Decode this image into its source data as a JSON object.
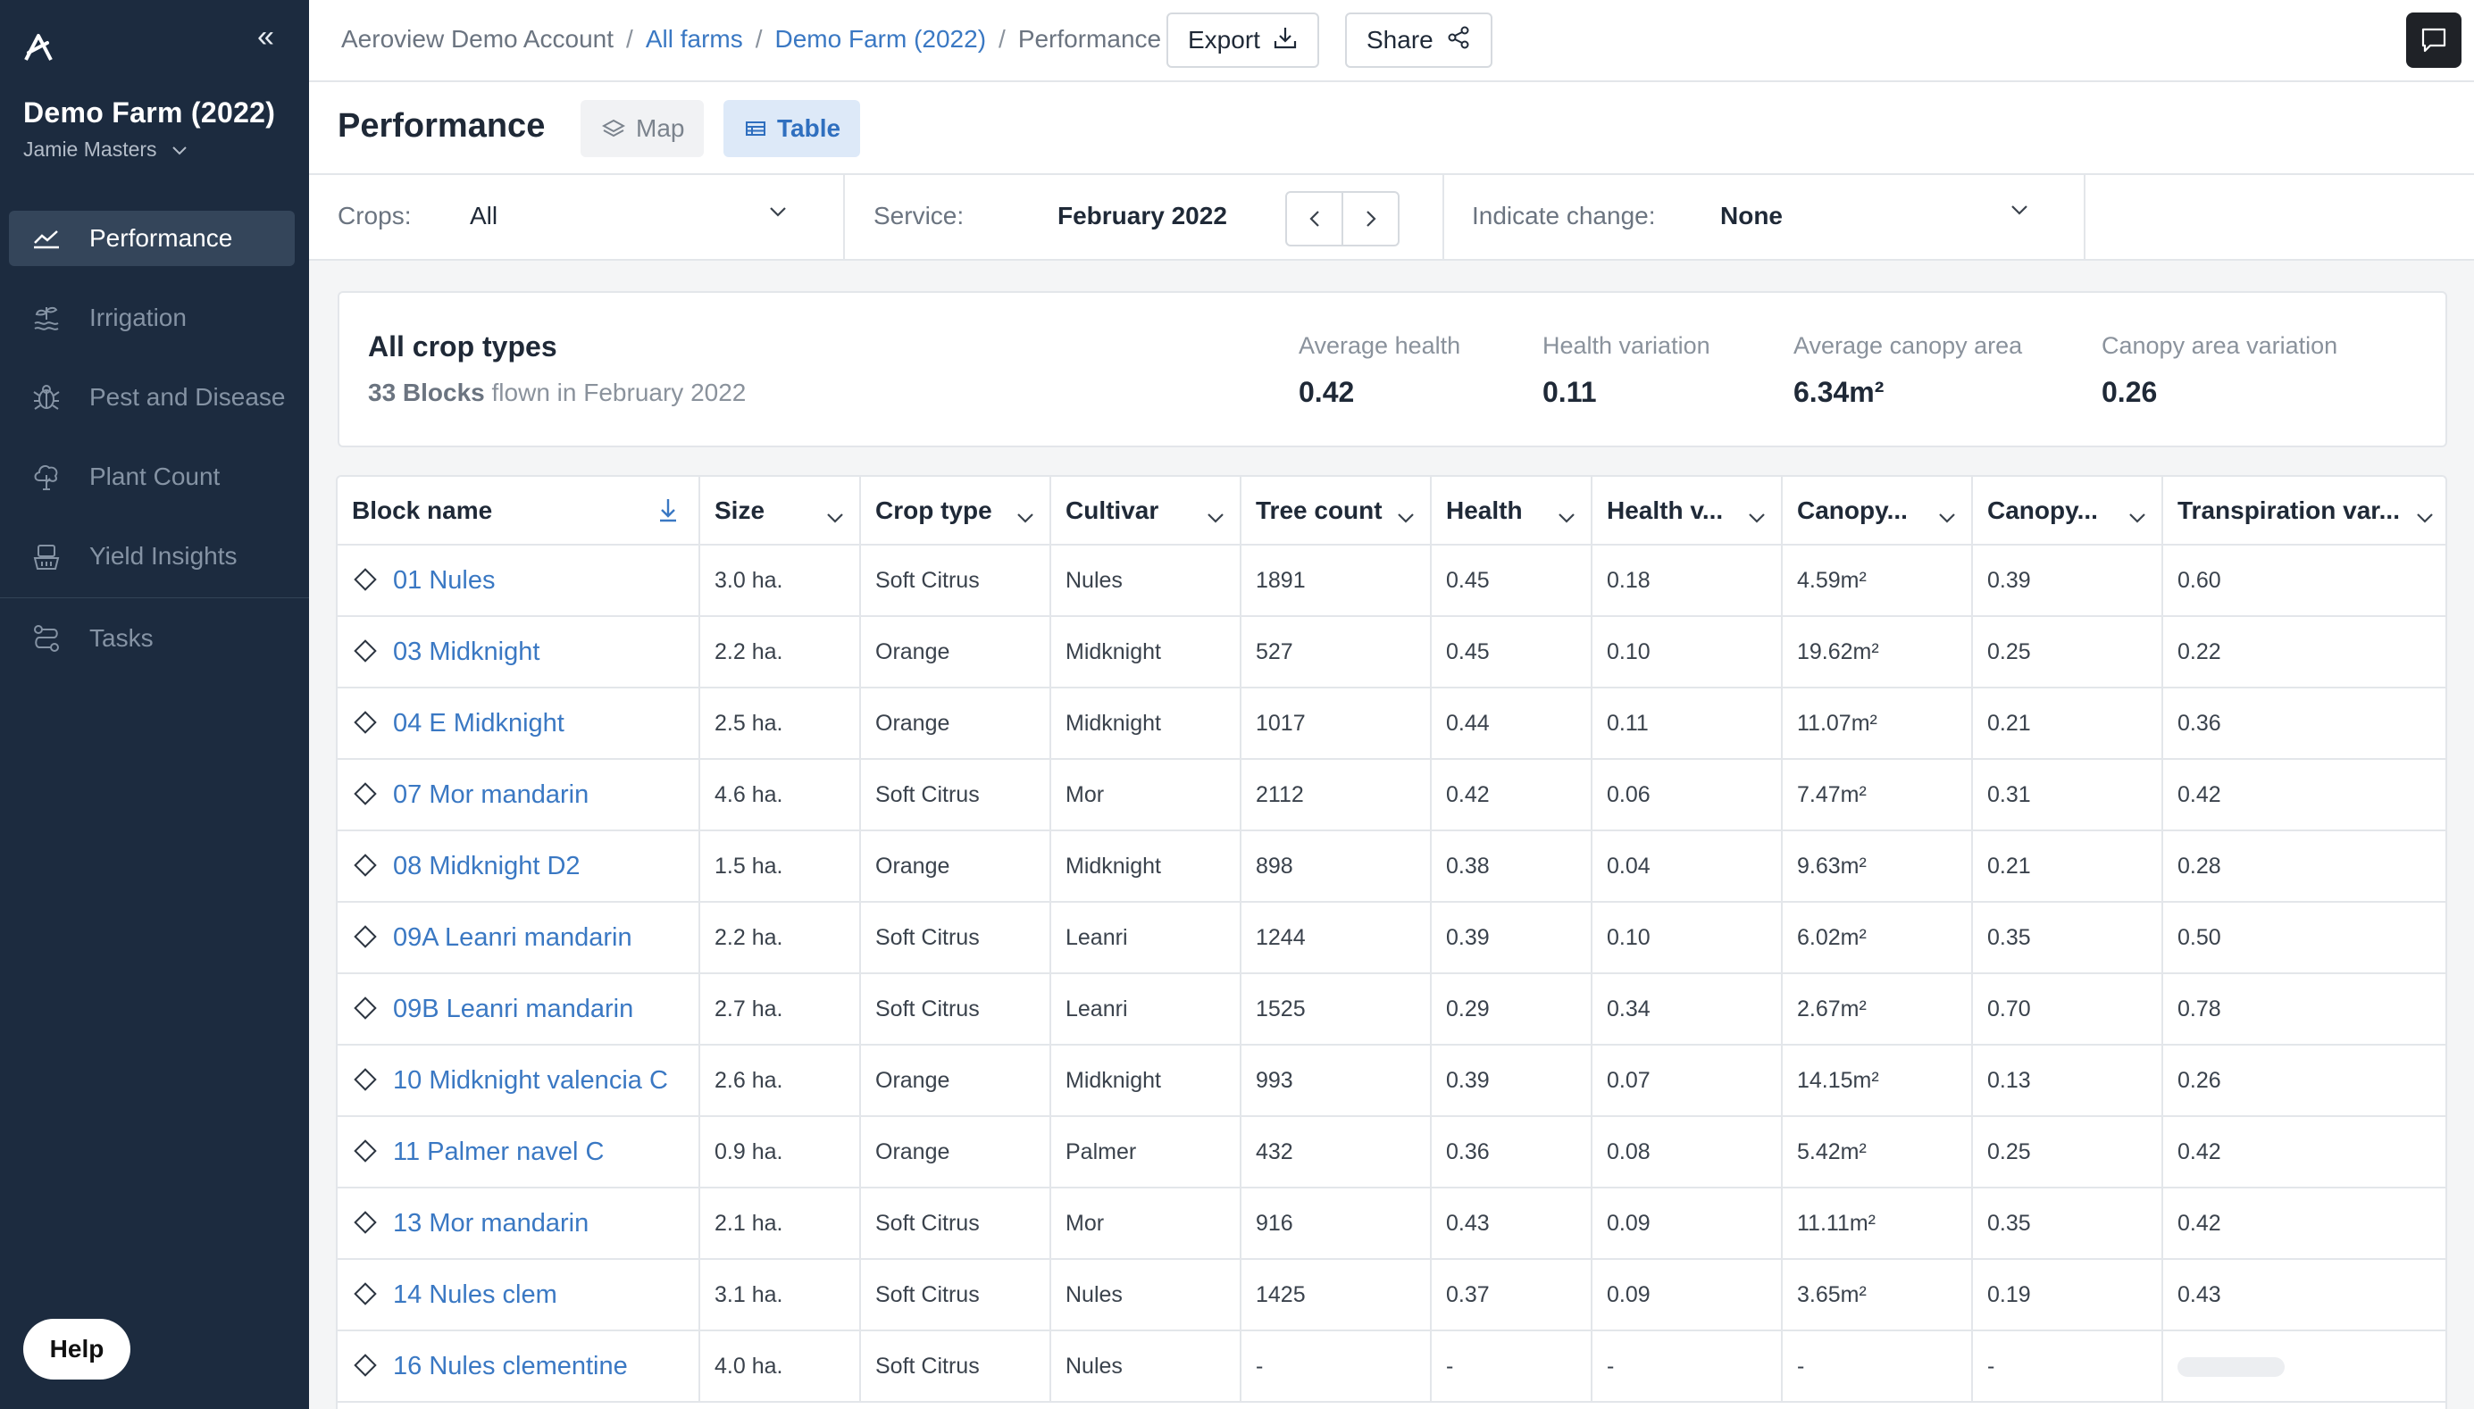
{
  "sidebar": {
    "farm_title": "Demo Farm (2022)",
    "user_name": "Jamie Masters",
    "nav": [
      {
        "label": "Performance",
        "icon": "chart-line-icon",
        "active": true
      },
      {
        "label": "Irrigation",
        "icon": "sprout-water-icon"
      },
      {
        "label": "Pest and Disease",
        "icon": "bug-icon"
      },
      {
        "label": "Plant Count",
        "icon": "tree-icon"
      },
      {
        "label": "Yield Insights",
        "icon": "basket-icon"
      },
      {
        "label": "Tasks",
        "icon": "route-icon"
      }
    ],
    "help_label": "Help"
  },
  "breadcrumb": {
    "account": "Aeroview Demo Account",
    "all_farms": "All farms",
    "farm": "Demo Farm (2022)",
    "current": "Performance"
  },
  "toolbar": {
    "export_label": "Export",
    "share_label": "Share"
  },
  "page": {
    "title": "Performance",
    "view_tabs": {
      "map": "Map",
      "table": "Table",
      "active": "Table"
    }
  },
  "filters": {
    "crops_label": "Crops:",
    "crops_value": "All",
    "service_label": "Service:",
    "service_value": "February 2022",
    "indicate_label": "Indicate change:",
    "indicate_value": "None"
  },
  "summary": {
    "title": "All crop types",
    "blocks_count": "33 Blocks",
    "blocks_suffix": "flown in February 2022",
    "stats": [
      {
        "label": "Average health",
        "value": "0.42"
      },
      {
        "label": "Health variation",
        "value": "0.11"
      },
      {
        "label": "Average canopy area",
        "value": "6.34m²"
      },
      {
        "label": "Canopy area variation",
        "value": "0.26"
      }
    ]
  },
  "table": {
    "columns": [
      "Block name",
      "Size",
      "Crop type",
      "Cultivar",
      "Tree count",
      "Health",
      "Health v...",
      "Canopy...",
      "Canopy...",
      "Transpiration var..."
    ],
    "rows": [
      [
        "01 Nules",
        "3.0 ha.",
        "Soft Citrus",
        "Nules",
        "1891",
        "0.45",
        "0.18",
        "4.59m²",
        "0.39",
        "0.60"
      ],
      [
        "03 Midknight",
        "2.2 ha.",
        "Orange",
        "Midknight",
        "527",
        "0.45",
        "0.10",
        "19.62m²",
        "0.25",
        "0.22"
      ],
      [
        "04 E Midknight",
        "2.5 ha.",
        "Orange",
        "Midknight",
        "1017",
        "0.44",
        "0.11",
        "11.07m²",
        "0.21",
        "0.36"
      ],
      [
        "07 Mor mandarin",
        "4.6 ha.",
        "Soft Citrus",
        "Mor",
        "2112",
        "0.42",
        "0.06",
        "7.47m²",
        "0.31",
        "0.42"
      ],
      [
        "08 Midknight D2",
        "1.5 ha.",
        "Orange",
        "Midknight",
        "898",
        "0.38",
        "0.04",
        "9.63m²",
        "0.21",
        "0.28"
      ],
      [
        "09A Leanri mandarin",
        "2.2 ha.",
        "Soft Citrus",
        "Leanri",
        "1244",
        "0.39",
        "0.10",
        "6.02m²",
        "0.35",
        "0.50"
      ],
      [
        "09B Leanri mandarin",
        "2.7 ha.",
        "Soft Citrus",
        "Leanri",
        "1525",
        "0.29",
        "0.34",
        "2.67m²",
        "0.70",
        "0.78"
      ],
      [
        "10 Midknight valencia C",
        "2.6 ha.",
        "Orange",
        "Midknight",
        "993",
        "0.39",
        "0.07",
        "14.15m²",
        "0.13",
        "0.26"
      ],
      [
        "11 Palmer navel C",
        "0.9 ha.",
        "Orange",
        "Palmer",
        "432",
        "0.36",
        "0.08",
        "5.42m²",
        "0.25",
        "0.42"
      ],
      [
        "13 Mor mandarin",
        "2.1 ha.",
        "Soft Citrus",
        "Mor",
        "916",
        "0.43",
        "0.09",
        "11.11m²",
        "0.35",
        "0.42"
      ],
      [
        "14 Nules clem",
        "3.1 ha.",
        "Soft Citrus",
        "Nules",
        "1425",
        "0.37",
        "0.09",
        "3.65m²",
        "0.19",
        "0.43"
      ],
      [
        "16 Nules clementine",
        "4.0 ha.",
        "Soft Citrus",
        "Nules",
        "-",
        "-",
        "-",
        "-",
        "-",
        ""
      ]
    ]
  }
}
